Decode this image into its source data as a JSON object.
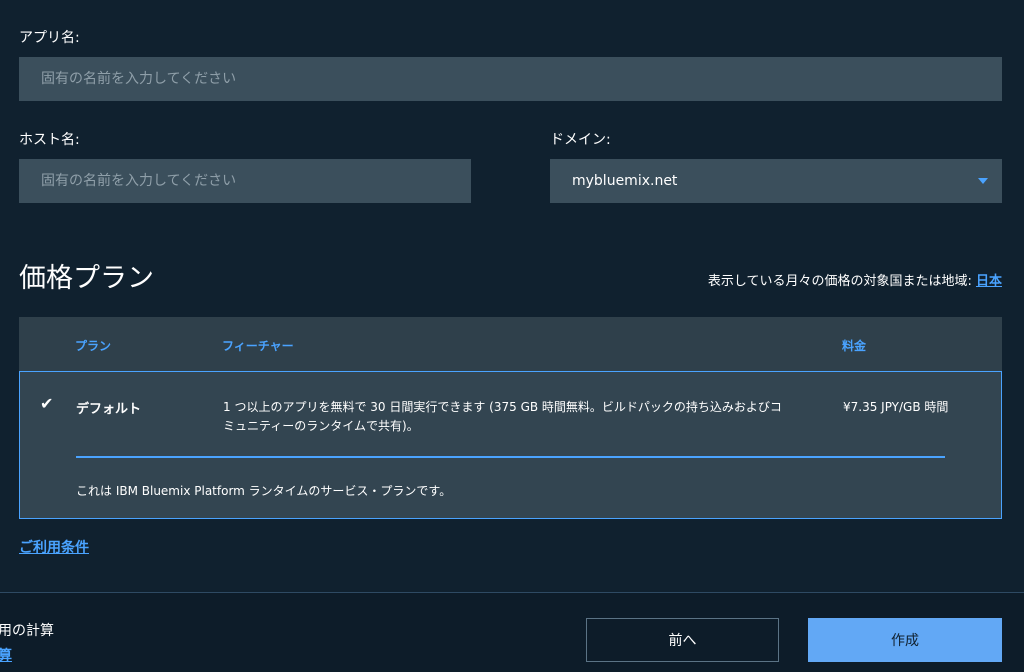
{
  "form": {
    "app_name_label": "アプリ名:",
    "app_name_placeholder": "固有の名前を入力してください",
    "app_name_value": "",
    "host_name_label": "ホスト名:",
    "host_name_placeholder": "固有の名前を入力してください",
    "host_name_value": "",
    "domain_label": "ドメイン:",
    "domain_value": "mybluemix.net"
  },
  "pricing": {
    "title": "価格プラン",
    "region_note": "表示している月々の価格の対象国または地域: ",
    "region_link": "日本",
    "columns": {
      "plan": "プラン",
      "features": "フィーチャー",
      "price": "料金"
    },
    "selected_plan": {
      "check": "✔",
      "name": "デフォルト",
      "features": "1 つ以上のアプリを無料で 30 日間実行できます (375 GB 時間無料。ビルドパックの持ち込みおよびコミュニティーのランタイムで共有)。",
      "price": "¥7.35 JPY/GB 時間",
      "description": "これは IBM Bluemix Platform ランタイムのサービス・プランです。"
    },
    "terms_link": "ご利用条件"
  },
  "footer": {
    "summary_label": "用の計算",
    "summary_link": "算",
    "back_label": "前へ",
    "create_label": "作成"
  },
  "colors": {
    "background": "#10212f",
    "input_bg": "#3b4f5c",
    "accent": "#4aa3ff",
    "primary_button": "#62a8f5"
  }
}
